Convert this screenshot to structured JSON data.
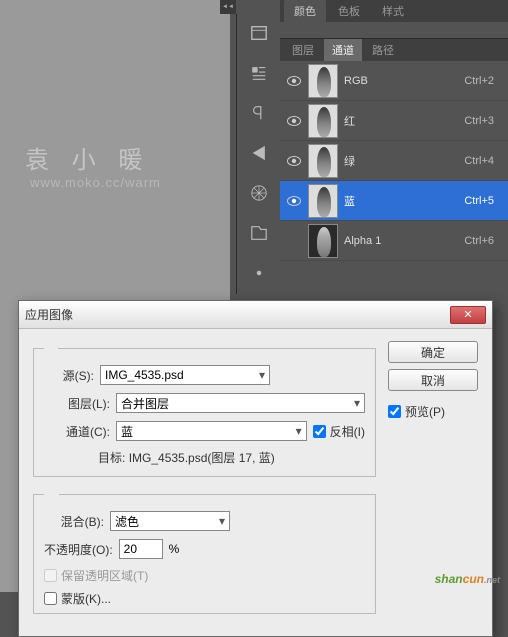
{
  "watermark": {
    "text": "袁 小 暖",
    "url": "www.moko.cc/warm"
  },
  "top_tabs": [
    "颜色",
    "色板",
    "样式"
  ],
  "sub_tabs": [
    "图层",
    "通道",
    "路径"
  ],
  "active_sub_tab": 1,
  "channels": [
    {
      "name": "RGB",
      "shortcut": "Ctrl+2",
      "visible": true,
      "selected": false,
      "dark": false
    },
    {
      "name": "红",
      "shortcut": "Ctrl+3",
      "visible": true,
      "selected": false,
      "dark": false
    },
    {
      "name": "绿",
      "shortcut": "Ctrl+4",
      "visible": true,
      "selected": false,
      "dark": false
    },
    {
      "name": "蓝",
      "shortcut": "Ctrl+5",
      "visible": true,
      "selected": true,
      "dark": false
    },
    {
      "name": "Alpha 1",
      "shortcut": "Ctrl+6",
      "visible": false,
      "selected": false,
      "dark": true
    }
  ],
  "dialog": {
    "title": "应用图像",
    "ok": "确定",
    "cancel": "取消",
    "preview_label": "预览(P)",
    "preview_checked": true,
    "source_label": "源(S):",
    "source_value": "IMG_4535.psd",
    "layer_label": "图层(L):",
    "layer_value": "合并图层",
    "channel_label": "通道(C):",
    "channel_value": "蓝",
    "invert_label": "反相(I)",
    "invert_checked": true,
    "target_label": "目标:",
    "target_value": "IMG_4535.psd(图层 17, 蓝)",
    "blend_label": "混合(B):",
    "blend_value": "滤色",
    "opacity_label": "不透明度(O):",
    "opacity_value": "20",
    "opacity_suffix": "%",
    "preserve_trans_label": "保留透明区域(T)",
    "preserve_trans_checked": false,
    "preserve_trans_disabled": true,
    "mask_label": "蒙版(K)...",
    "mask_checked": false
  },
  "logo": {
    "p1": "shan",
    "p2": "cun",
    "p3": ".net"
  }
}
